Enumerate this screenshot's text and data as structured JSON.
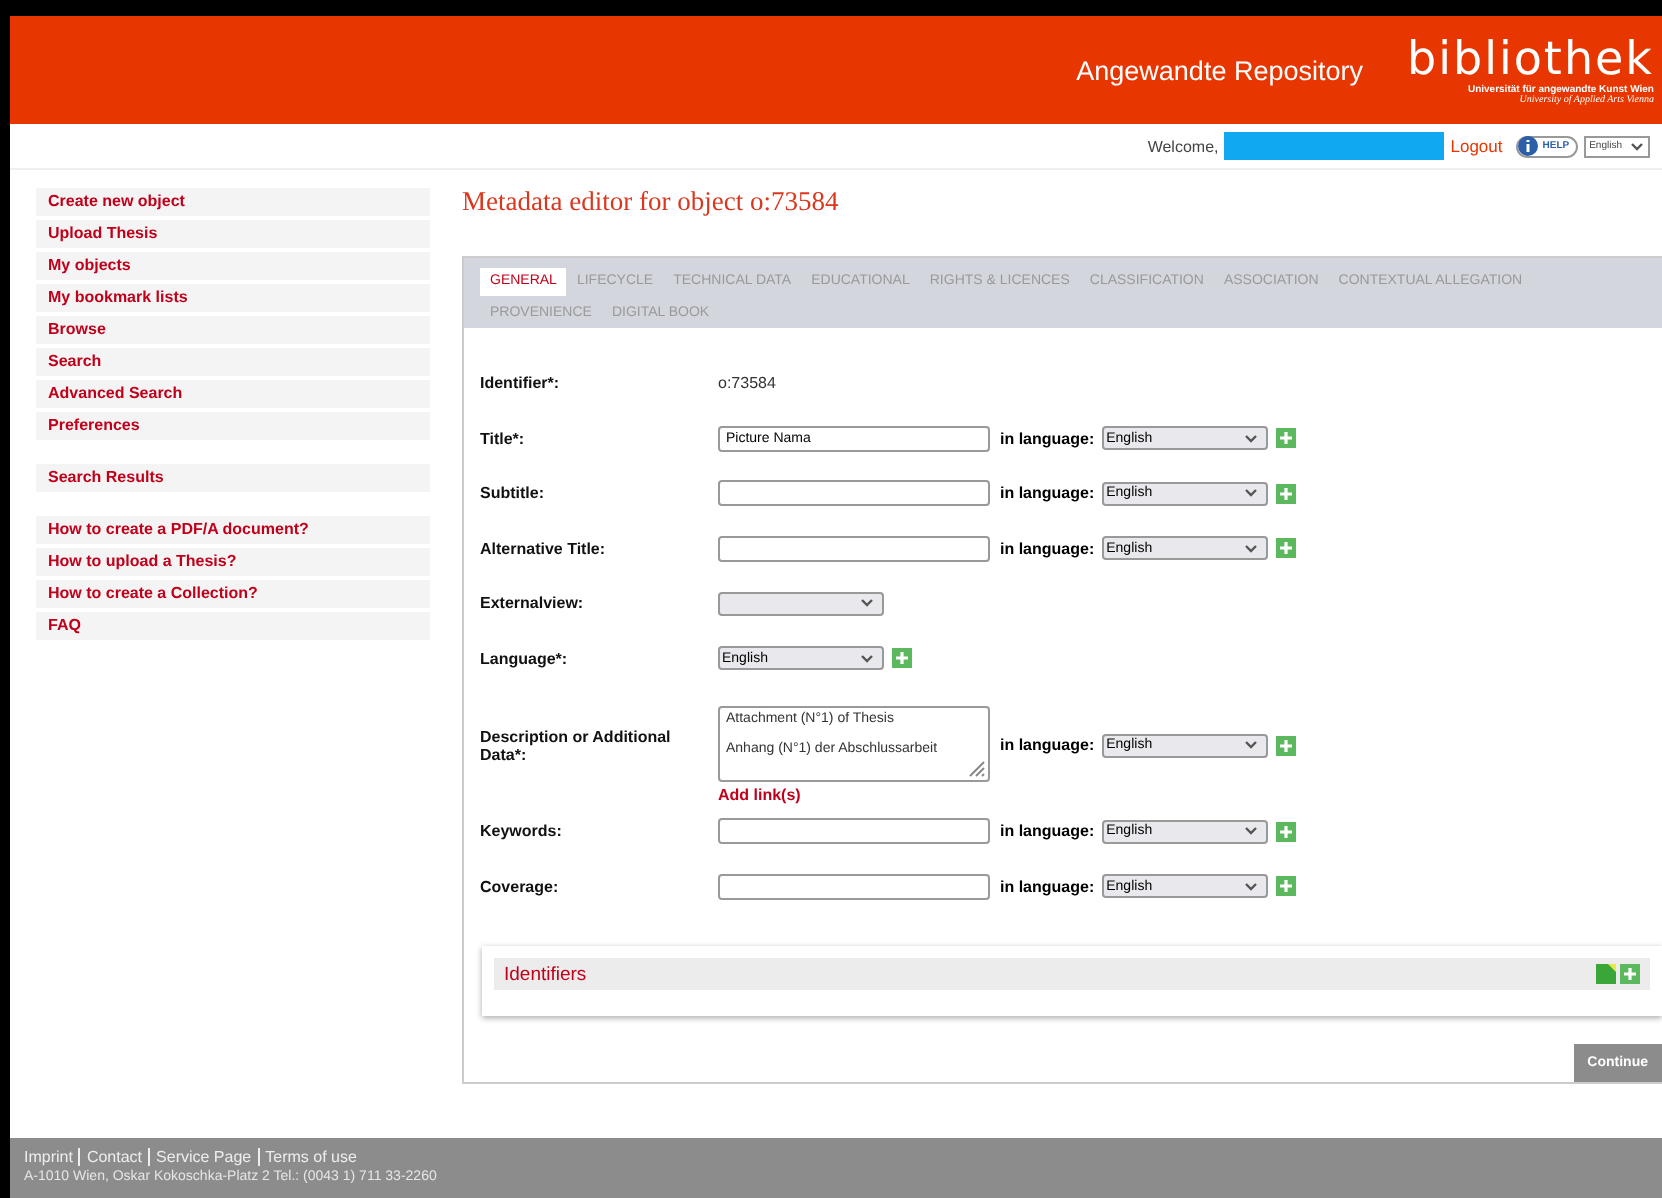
{
  "header": {
    "site_title": "Angewandte Repository",
    "logo": "bibliothek",
    "logo_sub": "Universität für angewandte Kunst Wien",
    "logo_sub2": "University of Applied Arts Vienna"
  },
  "userbar": {
    "welcome": "Welcome,",
    "logout": "Logout",
    "help": "HELP",
    "language": "English"
  },
  "sidebar": {
    "groups": [
      {
        "items": [
          "Create new object",
          "Upload Thesis",
          "My objects",
          "My bookmark lists",
          "Browse",
          "Search",
          "Advanced Search",
          "Preferences"
        ]
      },
      {
        "items": [
          "Search Results"
        ]
      },
      {
        "items": [
          "How to create a PDF/A document?",
          "How to upload a Thesis?",
          "How to create a Collection?",
          "FAQ"
        ]
      }
    ]
  },
  "page_title": "Metadata editor for object o:73584",
  "tabs": [
    {
      "label": "GENERAL",
      "selected": true
    },
    {
      "label": "LIFECYCLE",
      "selected": false
    },
    {
      "label": "TECHNICAL DATA",
      "selected": false
    },
    {
      "label": "EDUCATIONAL",
      "selected": false
    },
    {
      "label": "RIGHTS & LICENCES",
      "selected": false
    },
    {
      "label": "CLASSIFICATION",
      "selected": false
    },
    {
      "label": "ASSOCIATION",
      "selected": false
    },
    {
      "label": "CONTEXTUAL ALLEGATION",
      "selected": false
    },
    {
      "label": "PROVENIENCE",
      "selected": false
    },
    {
      "label": "DIGITAL BOOK",
      "selected": false
    }
  ],
  "fields": [
    {
      "kind": "static",
      "label": "Identifier*:",
      "value": "o:73584"
    },
    {
      "kind": "text",
      "label": "Title*:",
      "value": "Picture Nama",
      "language_label": "in language:",
      "language": "English"
    },
    {
      "kind": "text",
      "label": "Subtitle:",
      "language_label": "in language:",
      "language": "English"
    },
    {
      "kind": "text",
      "label": "Alternative Title:",
      "language_label": "in language:",
      "language": "English"
    },
    {
      "kind": "select",
      "label": "Externalview:"
    },
    {
      "kind": "select",
      "label": "Language*:",
      "value": "English",
      "addable": true
    },
    {
      "kind": "textarea",
      "label": "Description or Additional Data*:",
      "lines": [
        "Attachment (N°1) of Thesis",
        "Anhang (N°1) der Abschlussarbeit"
      ],
      "link": "Add link(s)",
      "language_label": "in language:",
      "language": "English"
    },
    {
      "kind": "text",
      "label": "Keywords:",
      "language_label": "in language:",
      "language": "English"
    },
    {
      "kind": "text",
      "label": "Coverage:",
      "language_label": "in language:",
      "language": "English"
    }
  ],
  "identifiers": {
    "title": "Identifiers"
  },
  "continue_button": "Continue",
  "footer": {
    "links": [
      "Imprint",
      "Contact",
      "Service Page",
      "Terms of use"
    ],
    "address": "A-1010 Wien, Oskar Kokoschka-Platz 2 Tel.: (0043 1) 711 33-2260"
  }
}
